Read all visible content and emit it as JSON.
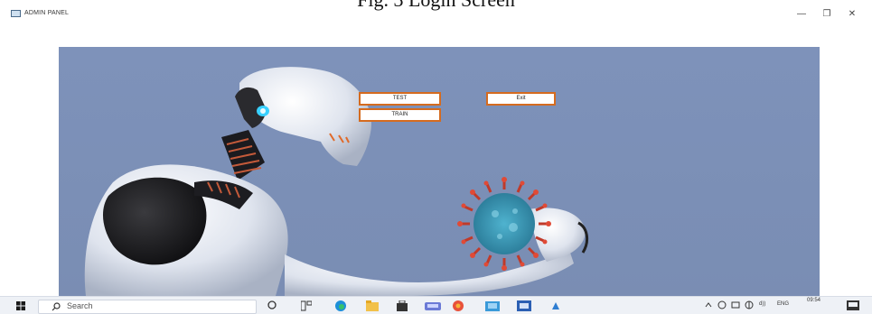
{
  "caption": "Fig. 3 Login Screen",
  "window": {
    "title": "ADMIN PANEL",
    "minimize_symbol": "—",
    "maximize_symbol": "❐",
    "close_symbol": "✕"
  },
  "buttons": {
    "test": "TEST",
    "train": "TRAIN",
    "exit": "Exit"
  },
  "taskbar": {
    "search_placeholder": "Search",
    "language": "ENG",
    "time": "09:54"
  },
  "colors": {
    "background": "#7b8fb6",
    "button_border": "#d56b1f",
    "taskbar": "#eef1f6"
  },
  "icons": [
    "app-icon",
    "windows-start-icon",
    "search-icon",
    "task-view-icon",
    "widgets-icon",
    "edge-icon",
    "file-explorer-icon",
    "store-icon",
    "teams-icon",
    "photos-icon",
    "mail-icon",
    "word-icon",
    "app-icon-generic",
    "chevron-up-icon",
    "network-icon",
    "volume-icon",
    "notification-icon"
  ]
}
